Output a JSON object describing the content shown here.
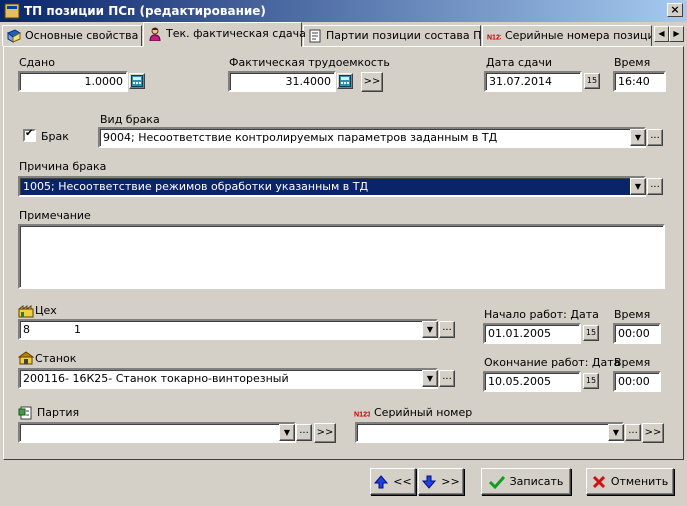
{
  "window": {
    "title": "ТП позиции ПСп (редактирование)",
    "close_label": "×"
  },
  "tabs": [
    {
      "label": "Основные свойства",
      "icon": "book-icon"
    },
    {
      "label": "Тек. фактическая сдача",
      "icon": "person-icon"
    },
    {
      "label": "Партии позиции состава ПСп",
      "icon": "document-icon"
    },
    {
      "label": "Серийные номера позиции",
      "icon": "serial-number-icon"
    }
  ],
  "tab_arrows": {
    "left": "◀",
    "right": "▶"
  },
  "form": {
    "sdano": {
      "label": "Сдано",
      "value": "1.0000"
    },
    "fact_labor": {
      "label": "Фактическая трудоемкость",
      "value": "31.4000",
      "more": ">>"
    },
    "date_delivery": {
      "label": "Дата сдачи",
      "value": "31.07.2014",
      "cal": "15"
    },
    "time_delivery": {
      "label": "Время",
      "value": "16:40"
    },
    "defect": {
      "label": "Брак",
      "checked": true,
      "check_mark": "✔"
    },
    "defect_type": {
      "label": "Вид брака",
      "value": "9004; Несоответствие контролируемых параметров заданным в ТД"
    },
    "defect_reason": {
      "label": "Причина брака",
      "value": "1005; Несоответствие режимов обработки указанным в ТД"
    },
    "note": {
      "label": "Примечание",
      "value": ""
    },
    "workshop": {
      "label": "Цех",
      "code": "8",
      "name": "1"
    },
    "machine": {
      "label": "Станок",
      "value": "200116- 16К25- Станок токарно-винторезный"
    },
    "start_work": {
      "label": "Начало работ: Дата",
      "date": "01.01.2005",
      "time_label": "Время",
      "time": "00:00"
    },
    "end_work": {
      "label": "Окончание работ: Дата",
      "date": "10.05.2005",
      "time_label": "Время",
      "time": "00:00"
    },
    "batch": {
      "label": "Партия",
      "value": "",
      "more": ">>"
    },
    "serial": {
      "label": "Серийный номер",
      "value": "",
      "more": ">>"
    },
    "dropdown_glyph": "▼",
    "ellipsis_glyph": "..."
  },
  "buttons": {
    "prev": "<<",
    "next": ">>",
    "save": "Записать",
    "cancel": "Отменить"
  }
}
